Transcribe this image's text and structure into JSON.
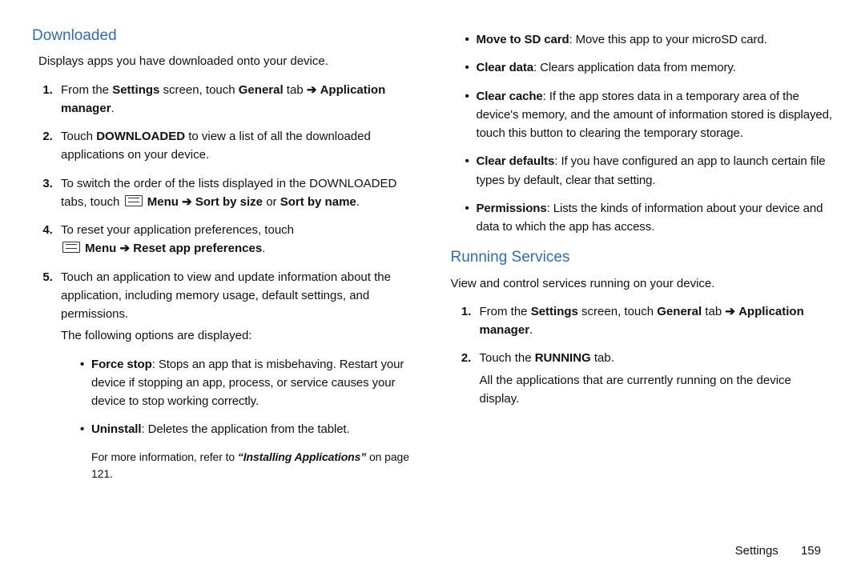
{
  "left": {
    "heading": "Downloaded",
    "intro": "Displays apps you have downloaded onto your device.",
    "step1_a": "From the ",
    "step1_b1": "Settings",
    "step1_c": " screen, touch ",
    "step1_b2": "General",
    "step1_d": " tab ",
    "step1_arrow": "➔",
    "step1_b3": "Application manager",
    "step1_e": ".",
    "step2_a": "Touch ",
    "step2_b": "DOWNLOADED",
    "step2_c": " to view a list of all the downloaded applications on your device.",
    "step3_a": "To switch the order of the lists displayed in the DOWNLOADED tabs, touch ",
    "step3_menu": "Menu",
    "step3_arrow": "➔",
    "step3_b": "Sort by size",
    "step3_c": " or ",
    "step3_d": "Sort by name",
    "step3_e": ".",
    "step4_a": "To reset your application preferences, touch ",
    "step4_menu": "Menu",
    "step4_arrow": "➔",
    "step4_b": "Reset app preferences",
    "step4_c": ".",
    "step5_a": "Touch an application to view and update information about the application, including memory usage, default settings, and permissions.",
    "step5_sub": "The following options are displayed:",
    "bul1_l": "Force stop",
    "bul1_t": ": Stops an app that is misbehaving. Restart your device if stopping an app, process, or service causes your device to stop working correctly.",
    "bul2_l": "Uninstall",
    "bul2_t": ": Deletes the application from the tablet.",
    "note_a": "For more information, refer to ",
    "note_b": "“Installing Applications”",
    "note_c": " on page 121."
  },
  "right": {
    "bul3_l": "Move to SD card",
    "bul3_t": ": Move this app to your microSD card.",
    "bul4_l": "Clear data",
    "bul4_t": ": Clears application data from memory.",
    "bul5_l": "Clear cache",
    "bul5_t": ": If the app stores data in a temporary area of the device's memory, and the amount of information stored is displayed, touch this button to clearing the temporary storage.",
    "bul6_l": "Clear defaults",
    "bul6_t": ": If you have configured an app to launch certain file types by default, clear that setting.",
    "bul7_l": "Permissions",
    "bul7_t": ": Lists the kinds of information about your device and data to which the app has access.",
    "heading2": "Running Services",
    "intro2": "View and control services running on your device.",
    "r1_a": "From the ",
    "r1_b1": "Settings",
    "r1_c": " screen, touch ",
    "r1_b2": "General",
    "r1_d": " tab ",
    "r1_arrow": "➔",
    "r1_b3": "Application manager",
    "r1_e": ".",
    "r2_a": "Touch the ",
    "r2_b": "RUNNING",
    "r2_c": " tab.",
    "r2_sub": "All the applications that are currently running on the device display."
  },
  "footer": {
    "label": "Settings",
    "page": "159"
  }
}
